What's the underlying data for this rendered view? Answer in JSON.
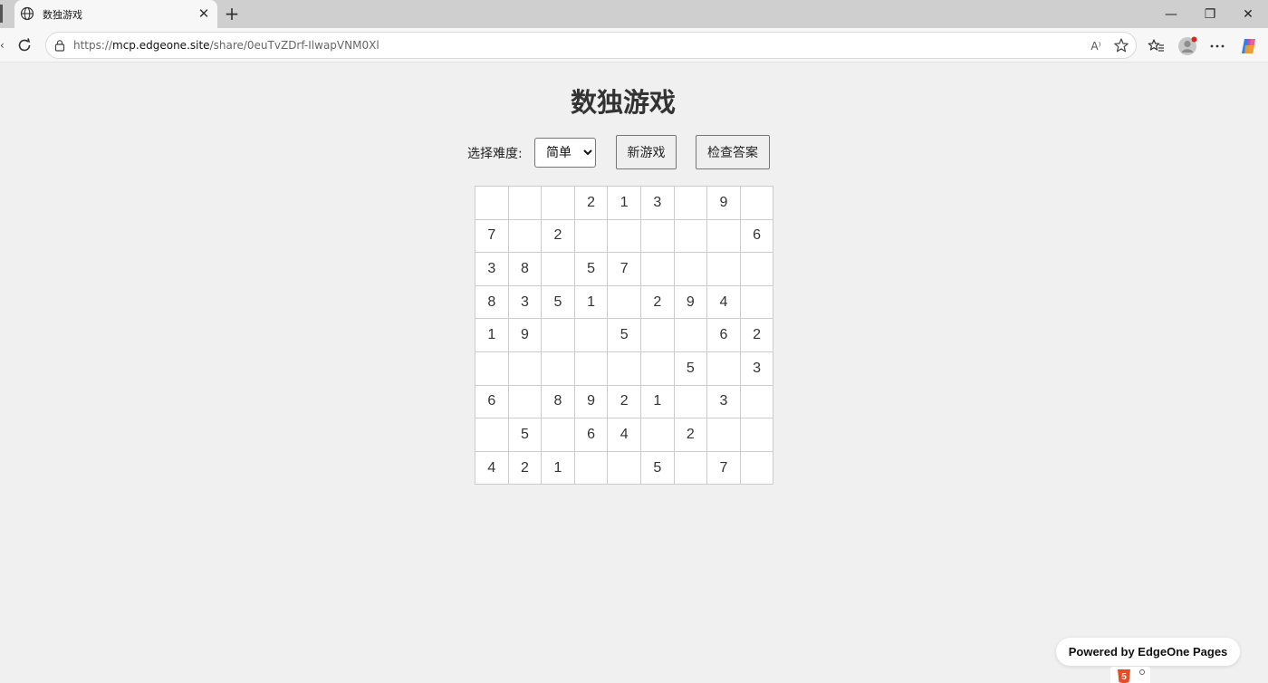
{
  "browser": {
    "tab_title": "数独游戏",
    "url_scheme": "https://",
    "url_host": "mcp.edgeone.site",
    "url_path": "/share/0euTvZDrf-IlwapVNM0Xl",
    "new_tab_label": "+",
    "tab_close_label": "✕",
    "read_aloud_label": "A⁾",
    "window_controls": {
      "minimize": "—",
      "restore": "❐",
      "close": "✕"
    }
  },
  "page": {
    "title": "数独游戏",
    "difficulty_label": "选择难度:",
    "difficulty_selected": "简单",
    "new_game_label": "新游戏",
    "check_answer_label": "检查答案",
    "powered_by": "Powered by EdgeOne Pages"
  },
  "board": [
    [
      "",
      "",
      "",
      "2",
      "1",
      "3",
      "",
      "9",
      ""
    ],
    [
      "7",
      "",
      "2",
      "",
      "",
      "",
      "",
      "",
      "6"
    ],
    [
      "3",
      "8",
      "",
      "5",
      "7",
      "",
      "",
      "",
      ""
    ],
    [
      "8",
      "3",
      "5",
      "1",
      "",
      "2",
      "9",
      "4",
      ""
    ],
    [
      "1",
      "9",
      "",
      "",
      "5",
      "",
      "",
      "6",
      "2"
    ],
    [
      "",
      "",
      "",
      "",
      "",
      "",
      "5",
      "",
      "3"
    ],
    [
      "6",
      "",
      "8",
      "9",
      "2",
      "1",
      "",
      "3",
      ""
    ],
    [
      "",
      "5",
      "",
      "6",
      "4",
      "",
      "2",
      "",
      ""
    ],
    [
      "4",
      "2",
      "1",
      "",
      "",
      "5",
      "",
      "7",
      ""
    ]
  ],
  "icons": {
    "tab": "globe-icon",
    "reload": "reload-icon",
    "lock": "lock-icon",
    "favorite": "star-icon",
    "favorites_bar": "favorites-icon",
    "profile": "avatar",
    "menu": "more-icon",
    "copilot": "copilot-icon",
    "badge": "html5-icon"
  }
}
